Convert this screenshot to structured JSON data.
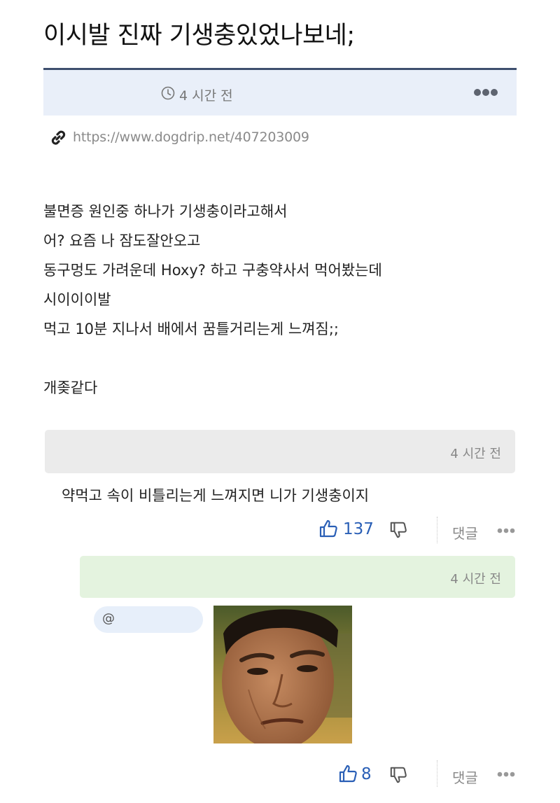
{
  "post": {
    "title": "이시발 진짜 기생충있었나보네;",
    "time": "4 시간 전",
    "url": "https://www.dogdrip.net/407203009",
    "lines": [
      "불면증 원인중 하나가 기생충이라고해서",
      "어? 요즘 나 잠도잘안오고",
      "동구멍도 가려운데 Hoxy? 하고 구충약사서 먹어봤는데",
      "시이이이발",
      "먹고 10분 지나서 배에서 꿈틀거리는게 느껴짐;;",
      "",
      "개좆같다"
    ]
  },
  "comments": [
    {
      "time": "4 시간 전",
      "text": "약먹고 속이 비틀리는게 느껴지면 니가 기생충이지",
      "likes": "137",
      "reply_label": "댓글"
    },
    {
      "time": "4 시간 전",
      "mention": "@",
      "likes": "8",
      "reply_label": "댓글"
    }
  ],
  "icons": {
    "clock": "clock-icon",
    "more": "more-icon",
    "link": "link-icon",
    "like": "thumbs-up-icon",
    "dislike": "thumbs-down-icon"
  },
  "colors": {
    "title_rule": "#3e4f6e",
    "meta_bar": "#e9eff9",
    "comment1_header": "#ebebeb",
    "comment2_header": "#e4f3df",
    "like_blue": "#2a5fb6",
    "mention_bg": "#e7effa"
  }
}
